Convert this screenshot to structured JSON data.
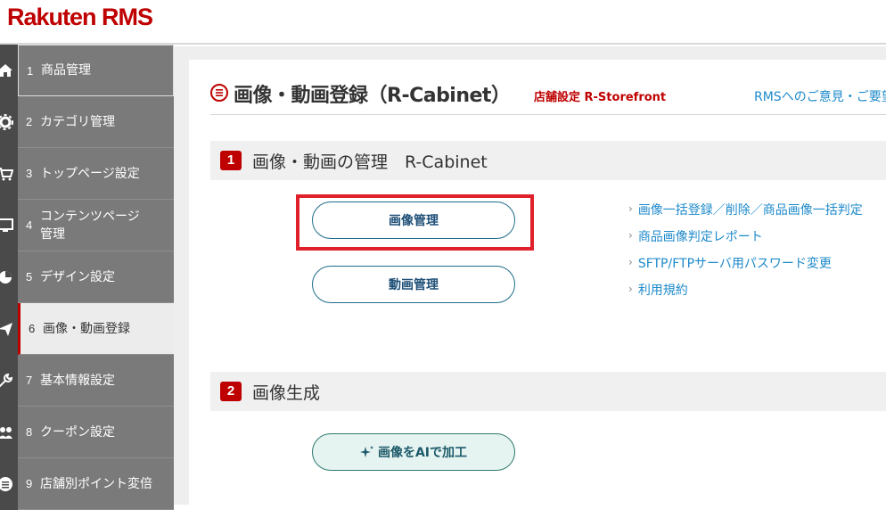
{
  "header": {
    "logo": "Rakuten RMS"
  },
  "sidebar": {
    "items": [
      {
        "num": "1",
        "label": "商品管理",
        "icon": "home-icon"
      },
      {
        "num": "2",
        "label": "カテゴリ管理",
        "icon": "gear-icon"
      },
      {
        "num": "3",
        "label": "トップページ設定",
        "icon": "cart-icon"
      },
      {
        "num": "4",
        "label": "コンテンツページ管理",
        "label_line1": "コンテンツページ",
        "label_line2": "管理",
        "icon": "monitor-icon"
      },
      {
        "num": "5",
        "label": "デザイン設定",
        "icon": "pie-chart-icon"
      },
      {
        "num": "6",
        "label": "画像・動画登録",
        "icon": "paper-plane-icon"
      },
      {
        "num": "7",
        "label": "基本情報設定",
        "icon": "tools-icon"
      },
      {
        "num": "8",
        "label": "クーポン設定",
        "icon": "users-icon"
      },
      {
        "num": "9",
        "label": "店舗別ポイント変倍",
        "icon": "list-icon"
      }
    ]
  },
  "page": {
    "title": "画像・動画登録（R-Cabinet）",
    "store_link": "店舗設定 R-Storefront",
    "feedback_link": "RMSへのご意見・ご要望"
  },
  "sections": [
    {
      "badge": "1",
      "title": "画像・動画の管理　R-Cabinet",
      "buttons": [
        "画像管理",
        "動画管理"
      ],
      "links": [
        "画像一括登録／削除／商品画像一括判定",
        "商品画像判定レポート",
        "SFTP/FTPサーバ用パスワード変更",
        "利用規約"
      ]
    },
    {
      "badge": "2",
      "title": "画像生成",
      "buttons": [
        "画像をAIで加工"
      ]
    }
  ],
  "colors": {
    "brand_red": "#bf0000",
    "link_blue": "#1e8acb",
    "sidebar_dark": "#7a7a7a",
    "highlight_red": "#e0202a"
  }
}
